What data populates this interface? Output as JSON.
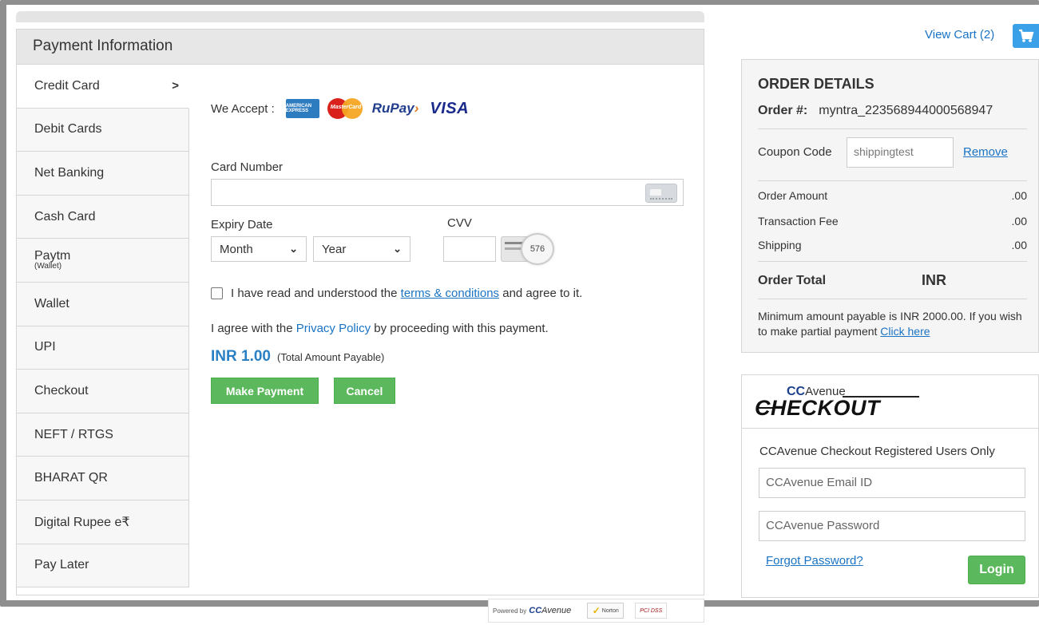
{
  "payment": {
    "header": "Payment Information",
    "tabs": [
      {
        "label": "Credit Card",
        "sub": "",
        "active": true
      },
      {
        "label": "Debit Cards",
        "sub": ""
      },
      {
        "label": "Net Banking",
        "sub": ""
      },
      {
        "label": "Cash Card",
        "sub": ""
      },
      {
        "label": "Paytm",
        "sub": "(Wallet)"
      },
      {
        "label": "Wallet",
        "sub": ""
      },
      {
        "label": "UPI",
        "sub": ""
      },
      {
        "label": "Checkout",
        "sub": ""
      },
      {
        "label": "NEFT / RTGS",
        "sub": ""
      },
      {
        "label": "BHARAT QR",
        "sub": ""
      },
      {
        "label": "Digital Rupee e₹",
        "sub": ""
      },
      {
        "label": "Pay Later",
        "sub": ""
      }
    ],
    "active_chevron": ">",
    "we_accept": "We Accept :",
    "card_logos": {
      "amex": "AMERICAN EXPRESS",
      "mastercard": "MasterCard",
      "rupay": "RuPay",
      "rupay_mark": "›",
      "visa": "VISA"
    },
    "card_number_label": "Card Number",
    "card_number_value": "",
    "expiry_label": "Expiry Date",
    "month_selected": "Month",
    "year_selected": "Year",
    "cvv_label": "CVV",
    "cvv_value": "",
    "cvv_hint": "576",
    "terms_prefix": "I have read and understood the ",
    "terms_link": "terms & conditions",
    "terms_suffix": " and agree to it.",
    "privacy_prefix": "I agree with the ",
    "privacy_link": "Privacy Policy",
    "privacy_suffix": " by proceeding with this payment.",
    "amount": "INR 1.00",
    "amount_note": "(Total Amount Payable)",
    "make_payment": "Make Payment",
    "cancel": "Cancel",
    "accent_color": "#5cb85c",
    "link_color": "#1a73c4"
  },
  "cart": {
    "view_cart": "View Cart (2)",
    "icon": "cart-icon"
  },
  "order": {
    "title": "ORDER DETAILS",
    "order_label": "Order #:",
    "order_id": "myntra_223568944000568947",
    "coupon_label": "Coupon Code",
    "coupon_value": "shippingtest",
    "remove": "Remove",
    "rows": [
      {
        "label": "Order Amount",
        "value": ".00"
      },
      {
        "label": "Transaction Fee",
        "value": ".00"
      },
      {
        "label": "Shipping",
        "value": ".00"
      }
    ],
    "total_label": "Order Total",
    "total_currency": "INR",
    "min_note": "Minimum amount payable is INR 2000.00. If you wish to make partial payment ",
    "click_here": "Click here"
  },
  "ccavenue": {
    "logo_cc": "CC",
    "logo_avenue": "Avenue",
    "logo_checkout": "CHECKOUT",
    "title": "CCAvenue Checkout Registered Users Only",
    "email_placeholder": "CCAvenue Email ID",
    "password_placeholder": "CCAvenue Password",
    "forgot": "Forgot Password?",
    "login": "Login"
  },
  "footer": {
    "powered_by": "Powered by",
    "cc": "CC",
    "avenue": "Avenue",
    "norton": "Norton",
    "pci": "PCI DSS"
  }
}
